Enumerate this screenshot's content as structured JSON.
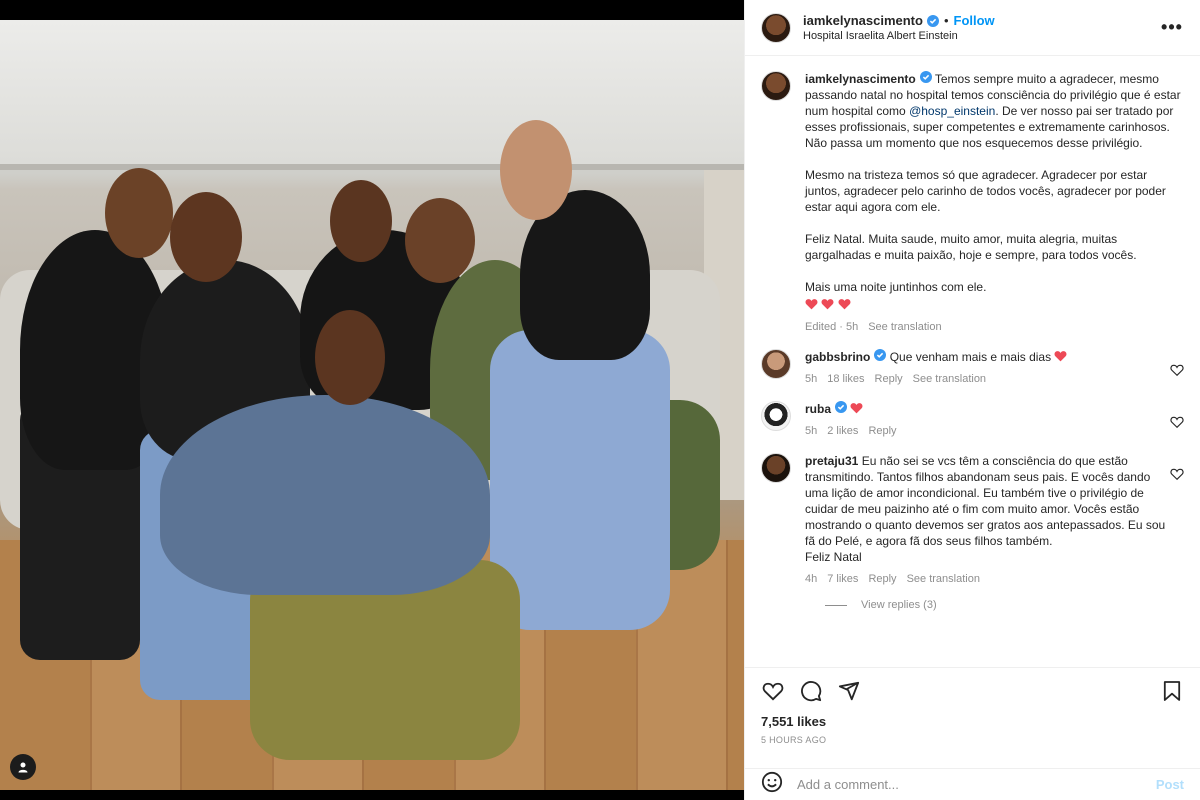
{
  "post": {
    "author": "iamkelynascimento",
    "follow_label": "Follow",
    "dot": "•",
    "location": "Hospital Israelita Albert Einstein",
    "more_label": "•••"
  },
  "caption": {
    "username": "iamkelynascimento",
    "text_before_mention": "Temos sempre muito a agradecer, mesmo passando natal no hospital temos consciência do privilégio que é estar num hospital como ",
    "mention": "@hosp_einstein",
    "text_after_mention": ". De ver nosso pai ser tratado por esses profissionais, super competentes e extremamente carinhosos.\nNão passa um momento que nos esquecemos desse privilégio.\n\nMesmo na tristeza temos só que agradecer. Agradecer por estar juntos, agradecer pelo carinho de todos vocês, agradecer por poder estar aqui agora com ele.\n\nFeliz Natal. Muita saude, muito amor, muita alegria, muitas gargalhadas e muita paixão, hoje e sempre, para todos vocês.\n\nMais uma noite juntinhos com ele.",
    "edited": "Edited · 5h",
    "see_translation": "See translation"
  },
  "comments": [
    {
      "username": "gabbsbrino",
      "text": "Que venham mais e mais dias",
      "time": "5h",
      "likes": "18 likes",
      "reply": "Reply",
      "see_translation": "See translation"
    },
    {
      "username": "ruba",
      "text": "",
      "time": "5h",
      "likes": "2 likes",
      "reply": "Reply"
    },
    {
      "username": "pretaju31",
      "text": "Eu não sei se vcs têm a consciência do que estão transmitindo. Tantos filhos abandonam seus pais. E vocês dando uma lição de amor incondicional. Eu também tive o privilégio de cuidar de meu paizinho até o fim com muito amor. Vocês estão mostrando o quanto devemos ser gratos aos antepassados. Eu sou fã do Pelé, e agora fã dos seus filhos também.\nFeliz Natal",
      "time": "4h",
      "likes": "7 likes",
      "reply": "Reply",
      "see_translation": "See translation",
      "view_replies": "View replies (3)"
    }
  ],
  "actions": {
    "likes": "7,551 likes",
    "time": "5 HOURS AGO"
  },
  "add_comment": {
    "placeholder": "Add a comment...",
    "post_label": "Post"
  },
  "icons": {
    "verified": "verified-badge-icon",
    "heart": "heart-icon",
    "comment": "comment-icon",
    "share": "share-icon",
    "save": "bookmark-icon",
    "emoji": "emoji-icon",
    "tagged_user": "user-tag-icon"
  },
  "colors": {
    "accent": "#0095f6",
    "verified": "#3897f0",
    "red_heart": "#ed4956",
    "muted": "#8e8e8e"
  }
}
